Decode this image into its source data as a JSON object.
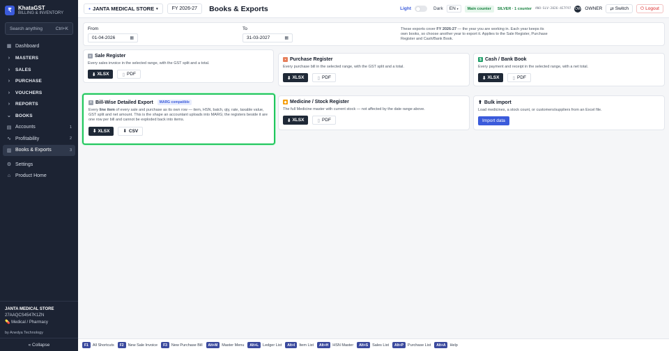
{
  "brand": {
    "logo": "₹",
    "name": "KhataGST",
    "subtitle": "BILLING & INVENTORY"
  },
  "sidebar": {
    "search_placeholder": "Search anything",
    "search_shortcut": "Ctrl+K",
    "items": [
      {
        "label": "Dashboard",
        "icon": "grid-icon",
        "glyph": "▦",
        "kind": "item"
      },
      {
        "label": "MASTERS",
        "glyph": "›",
        "kind": "section"
      },
      {
        "label": "SALES",
        "glyph": "›",
        "kind": "section"
      },
      {
        "label": "PURCHASE",
        "glyph": "›",
        "kind": "section"
      },
      {
        "label": "VOUCHERS",
        "glyph": "›",
        "kind": "section"
      },
      {
        "label": "REPORTS",
        "glyph": "›",
        "kind": "section"
      },
      {
        "label": "BOOKS",
        "glyph": "⌄",
        "kind": "section"
      },
      {
        "label": "Accounts",
        "glyph": "▤",
        "badge": "1",
        "kind": "item"
      },
      {
        "label": "Profitability",
        "glyph": "∿",
        "badge": "2",
        "kind": "item"
      },
      {
        "label": "Books & Exports",
        "glyph": "▥",
        "badge": "3",
        "kind": "active"
      },
      {
        "label": "Settings",
        "glyph": "⚙",
        "kind": "item"
      },
      {
        "label": "Product Home",
        "glyph": "⌂",
        "kind": "item"
      }
    ],
    "store_name": "JANTA MEDICAL STORE",
    "gstin": "27AAQCS4547K1ZN",
    "store_type": "Medical / Pharmacy",
    "by": "by Anedya Technology",
    "collapse": "« Collapse"
  },
  "header": {
    "store": "JANTA MEDICAL STORE",
    "fy": "FY 2026-27",
    "title": "Books & Exports",
    "light": "Light",
    "dark": "Dark",
    "lang": "EN",
    "counter": "Main counter",
    "plan": "SILVER · 1 counter",
    "license": "ANO-SLV-2026-4E7F97",
    "avatar": "OW",
    "role": "OWNER",
    "switch": "Switch",
    "logout": "Logout"
  },
  "range": {
    "from_label": "From",
    "from_value": "01-04-2026",
    "to_label": "To",
    "to_value": "31-03-2027",
    "note_pre": "These exports cover ",
    "note_fy": "FY 2026-27",
    "note_post": " — the year you are working in. Each year keeps its own books, so choose another year to export it. Applies to the Sale Register, Purchase Register and Cash/Bank Book."
  },
  "cards": {
    "sale": {
      "title": "Sale Register",
      "desc": "Every sales invoice in the selected range, with the GST split and a total.",
      "b1": "XLSX",
      "b2": "PDF"
    },
    "purchase": {
      "title": "Purchase Register",
      "desc": "Every purchase bill in the selected range, with the GST split and a total.",
      "b1": "XLSX",
      "b2": "PDF"
    },
    "cash": {
      "title": "Cash / Bank Book",
      "desc": "Every payment and receipt in the selected range, with a net total.",
      "b1": "XLSX",
      "b2": "PDF"
    },
    "billwise": {
      "title": "Bill-Wise Detailed Export",
      "badge": "MARG compatible",
      "desc_pre": "Every ",
      "desc_bold": "line item",
      "desc_post": " of every sale and purchase as its own row — item, HSN, batch, qty, rate, taxable value, GST split and net amount. This is the shape an accountant uploads into MARG; the registers beside it are one row per bill and cannot be exploded back into items.",
      "b1": "XLSX",
      "b2": "CSV"
    },
    "medicine": {
      "title": "Medicine / Stock Register",
      "desc": "The full Medicine master with current stock — not affected by the date range above.",
      "b1": "XLSX",
      "b2": "PDF"
    },
    "bulk": {
      "title": "Bulk import",
      "desc": "Load medicines, a stock count, or customers/suppliers from an Excel file.",
      "b1": "Import data"
    }
  },
  "shortcuts": [
    {
      "key": "F1",
      "label": "All Shortcuts"
    },
    {
      "key": "F2",
      "label": "New Sale Invoice"
    },
    {
      "key": "F3",
      "label": "New Purchase Bill"
    },
    {
      "key": "Alt+M",
      "label": "Master Menu"
    },
    {
      "key": "Alt+L",
      "label": "Ledger List"
    },
    {
      "key": "Alt+I",
      "label": "Item List"
    },
    {
      "key": "Alt+H",
      "label": "HSN Master"
    },
    {
      "key": "Alt+S",
      "label": "Sales List"
    },
    {
      "key": "Alt+P",
      "label": "Purchase List"
    },
    {
      "key": "Alt+A",
      "label": "Help"
    }
  ]
}
